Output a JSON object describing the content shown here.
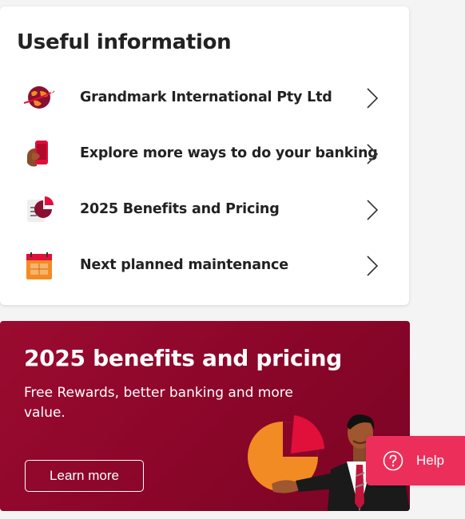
{
  "useful_info": {
    "title": "Useful information",
    "items": [
      {
        "label": "Grandmark International Pty Ltd",
        "icon": "globe-plane-icon"
      },
      {
        "label": "Explore more ways to do your banking",
        "icon": "phone-in-hand-icon"
      },
      {
        "label": "2025 Benefits and Pricing",
        "icon": "pie-chart-document-icon"
      },
      {
        "label": "Next planned maintenance",
        "icon": "calendar-icon"
      }
    ]
  },
  "promo": {
    "title": "2025 benefits and pricing",
    "subtitle": "Free Rewards, better banking and more value.",
    "button_label": "Learn more"
  },
  "help": {
    "label": "Help"
  },
  "colors": {
    "brand_crimson": "#8a0629",
    "help_pink": "#ec2f5a",
    "icon_orange": "#f28b24",
    "icon_red": "#e0103a"
  }
}
